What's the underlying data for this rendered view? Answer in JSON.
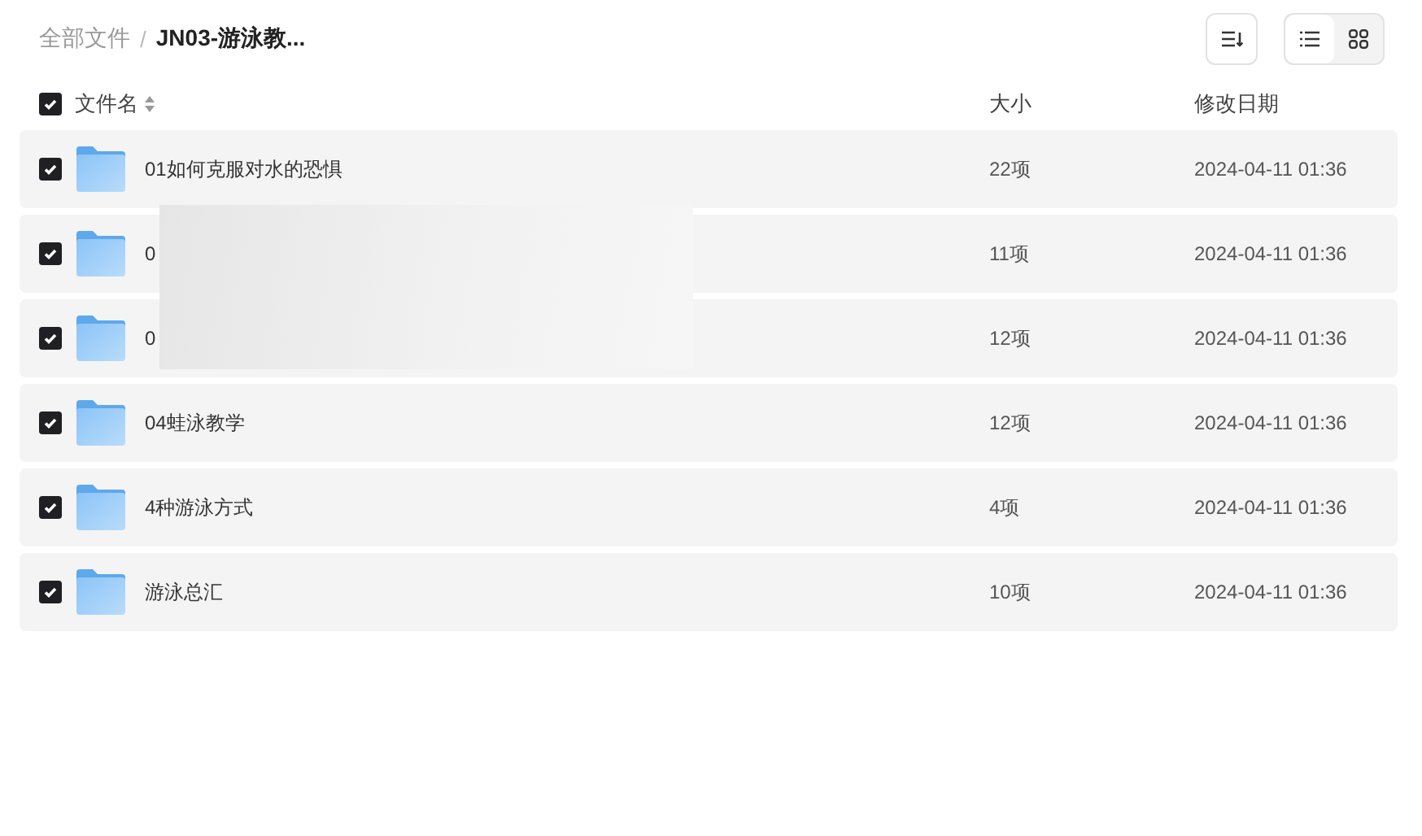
{
  "breadcrumb_separator": "/",
  "breadcrumb": [
    {
      "label": "全部文件",
      "current": false
    },
    {
      "label": "JN03-游泳教...",
      "current": true
    }
  ],
  "view_options": [
    {
      "kind": "list",
      "selected": true
    },
    {
      "kind": "grid",
      "selected": false
    }
  ],
  "header": {
    "select_all_checked": true,
    "columns": [
      "文件名",
      "大小",
      "修改日期"
    ]
  },
  "rows": [
    {
      "name": "01如何克服对水的恐惧",
      "size": "22项",
      "modified": "2024-04-11 01:36",
      "checked": true
    },
    {
      "name": "0",
      "size": "11项",
      "modified": "2024-04-11 01:36",
      "checked": true
    },
    {
      "name": "0",
      "size": "12项",
      "modified": "2024-04-11 01:36",
      "checked": true
    },
    {
      "name": "04蛙泳教学",
      "size": "12项",
      "modified": "2024-04-11 01:36",
      "checked": true
    },
    {
      "name": "4种游泳方式",
      "size": "4项",
      "modified": "2024-04-11 01:36",
      "checked": true
    },
    {
      "name": "游泳总汇",
      "size": "10项",
      "modified": "2024-04-11 01:36",
      "checked": true
    }
  ]
}
